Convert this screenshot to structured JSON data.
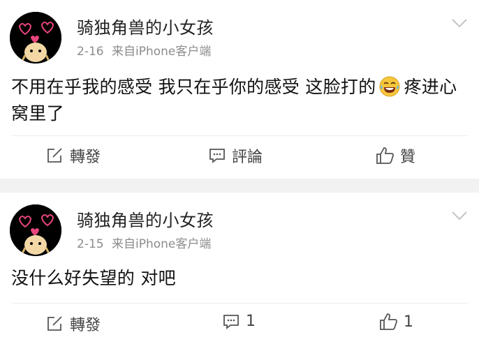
{
  "posts": [
    {
      "username": "骑独角兽的小女孩",
      "date": "2-16",
      "source": "来自iPhone客户端",
      "text_part1": "不用在乎我的感受 我只在乎你的感受 这脸打的",
      "text_part2": "疼进心窝里了",
      "emoji": "laughing-tears-emoji",
      "actions": {
        "repost_label": "轉發",
        "comment_label": "評論",
        "like_label": "贊"
      }
    },
    {
      "username": "骑独角兽的小女孩",
      "date": "2-15",
      "source": "来自iPhone客户端",
      "text_part1": "没什么好失望的 对吧",
      "actions": {
        "repost_label": "轉發",
        "comment_count": "1",
        "like_count": "1"
      }
    }
  ],
  "icons": {
    "repost": "edit-square-icon",
    "comment": "comment-bubble-icon",
    "like": "thumbs-up-icon",
    "more": "chevron-down-icon"
  },
  "colors": {
    "background": "#f2f2f2",
    "card": "#ffffff",
    "meta_text": "#8c8c8c",
    "avatar_accent": "#e8457a"
  }
}
